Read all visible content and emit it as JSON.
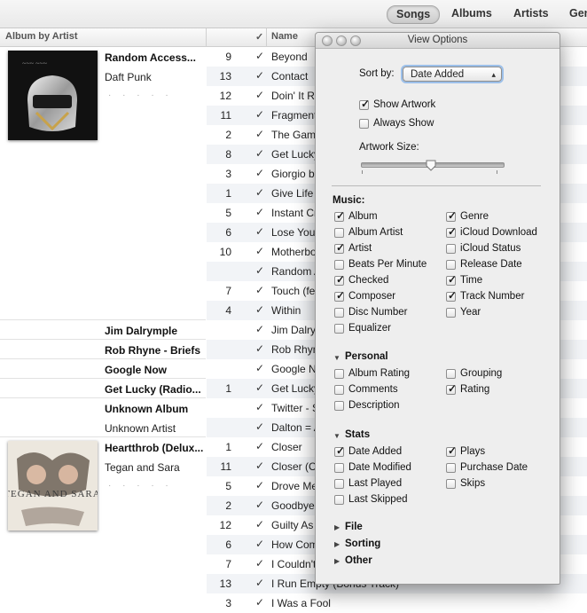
{
  "tabs": [
    "Songs",
    "Albums",
    "Artists",
    "Genres"
  ],
  "columns": {
    "album": "Album by Artist",
    "name": "Name"
  },
  "albums": [
    {
      "title": "Random Access...",
      "artist": "Daft Punk",
      "dots": "· · · · ·"
    },
    {
      "title": "Jim Dalrymple"
    },
    {
      "title": "Rob Rhyne - Briefs"
    },
    {
      "title": "Google Now"
    },
    {
      "title": "Get Lucky (Radio..."
    },
    {
      "title": "Unknown Album",
      "artist": "Unknown Artist"
    },
    {
      "title": "Heartthrob (Delux...",
      "artist": "Tegan and Sara",
      "dots": "· · · · ·"
    }
  ],
  "tracks": [
    {
      "num": "9",
      "name": "Beyond"
    },
    {
      "num": "13",
      "name": "Contact"
    },
    {
      "num": "12",
      "name": "Doin' It Right"
    },
    {
      "num": "11",
      "name": "Fragments of Time"
    },
    {
      "num": "2",
      "name": "The Game of Love"
    },
    {
      "num": "8",
      "name": "Get Lucky"
    },
    {
      "num": "3",
      "name": "Giorgio by Moroder"
    },
    {
      "num": "1",
      "name": "Give Life Back to Music"
    },
    {
      "num": "5",
      "name": "Instant Crush"
    },
    {
      "num": "6",
      "name": "Lose Yourself to Dance"
    },
    {
      "num": "10",
      "name": "Motherboard"
    },
    {
      "num": "",
      "name": "Random Access Memories"
    },
    {
      "num": "7",
      "name": "Touch (feat. Paul Williams)"
    },
    {
      "num": "4",
      "name": "Within"
    },
    {
      "num": "",
      "name": "Jim Dalrymple"
    },
    {
      "num": "",
      "name": "Rob Rhyne - Briefs"
    },
    {
      "num": "",
      "name": "Google Now"
    },
    {
      "num": "1",
      "name": "Get Lucky (Radio Edit)"
    },
    {
      "num": "",
      "name": "Twitter - Sound"
    },
    {
      "num": "",
      "name": "Dalton = Awesome"
    },
    {
      "num": "1",
      "name": "Closer"
    },
    {
      "num": "11",
      "name": "Closer (Cosmic Dawn Remix)"
    },
    {
      "num": "5",
      "name": "Drove Me Wild"
    },
    {
      "num": "2",
      "name": "Goodbye, Goodbye"
    },
    {
      "num": "12",
      "name": "Guilty As Charged"
    },
    {
      "num": "6",
      "name": "How Come You Don't Want Me"
    },
    {
      "num": "7",
      "name": "I Couldn't Be Your Friend"
    },
    {
      "num": "13",
      "name": "I Run Empty (Bonus Track)"
    },
    {
      "num": "3",
      "name": "I Was a Fool"
    }
  ],
  "panel": {
    "title": "View Options",
    "sort_label": "Sort by:",
    "sort_value": "Date Added",
    "show_artwork": "Show Artwork",
    "always_show": "Always Show",
    "artwork_size": "Artwork Size:",
    "artwork_size_fraction": 0.5,
    "music_header": "Music:",
    "music_options": [
      {
        "label": "Album",
        "checked": true
      },
      {
        "label": "Genre",
        "checked": true
      },
      {
        "label": "Album Artist",
        "checked": false
      },
      {
        "label": "iCloud Download",
        "checked": true
      },
      {
        "label": "Artist",
        "checked": true
      },
      {
        "label": "iCloud Status",
        "checked": false
      },
      {
        "label": "Beats Per Minute",
        "checked": false
      },
      {
        "label": "Release Date",
        "checked": false
      },
      {
        "label": "Checked",
        "checked": true
      },
      {
        "label": "Time",
        "checked": true
      },
      {
        "label": "Composer",
        "checked": true
      },
      {
        "label": "Track Number",
        "checked": true
      },
      {
        "label": "Disc Number",
        "checked": false
      },
      {
        "label": "Year",
        "checked": false
      },
      {
        "label": "Equalizer",
        "checked": false
      }
    ],
    "personal_header": "Personal",
    "personal_options": [
      {
        "label": "Album Rating",
        "checked": false
      },
      {
        "label": "Grouping",
        "checked": false
      },
      {
        "label": "Comments",
        "checked": false
      },
      {
        "label": "Rating",
        "checked": true
      },
      {
        "label": "Description",
        "checked": false
      }
    ],
    "stats_header": "Stats",
    "stats_options": [
      {
        "label": "Date Added",
        "checked": true
      },
      {
        "label": "Plays",
        "checked": true
      },
      {
        "label": "Date Modified",
        "checked": false
      },
      {
        "label": "Purchase Date",
        "checked": false
      },
      {
        "label": "Last Played",
        "checked": false
      },
      {
        "label": "Skips",
        "checked": false
      },
      {
        "label": "Last Skipped",
        "checked": false
      }
    ],
    "file_header": "File",
    "sorting_header": "Sorting",
    "other_header": "Other"
  }
}
